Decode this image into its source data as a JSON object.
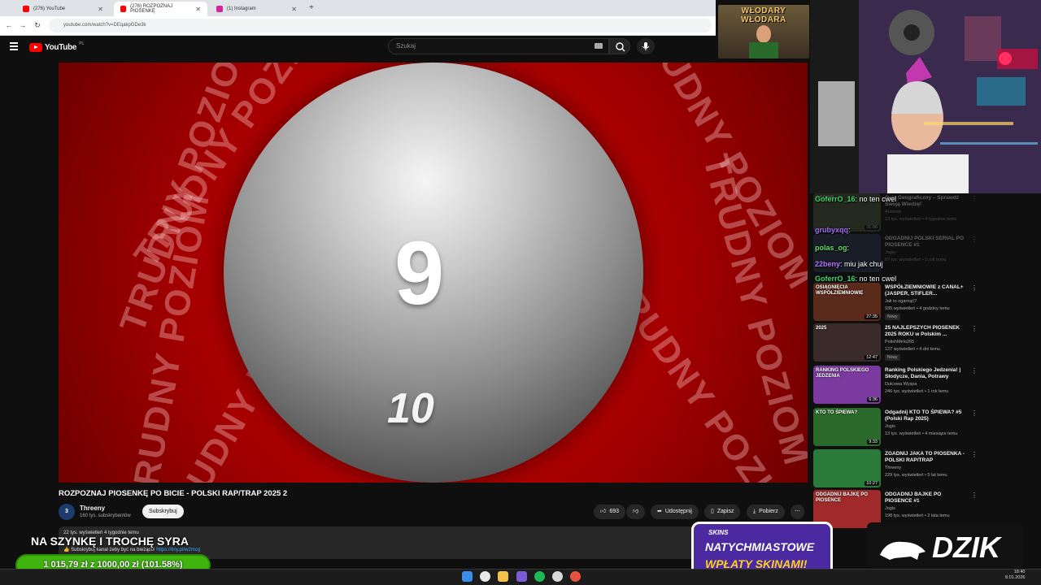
{
  "browser": {
    "tabs": [
      {
        "label": "(276) YouTube"
      },
      {
        "label": "(276) ROZPOZNAJ PIOSENKĘ"
      },
      {
        "label": "(1) Instagram"
      }
    ],
    "url": "youtube.com/watch?v=DEqakpGDe3k"
  },
  "header": {
    "logo": "YouTube",
    "country": "PL",
    "search_placeholder": "Szukaj"
  },
  "video": {
    "ring_text": "TRUDNY POZIOM",
    "big_number": "9",
    "small_number": "10",
    "title": "ROZPOZNAJ PIOSENKĘ PO BICIE - POLSKI RAP/TRAP 2025 2"
  },
  "channel": {
    "avatar_text": "3",
    "name": "Threeny",
    "subs": "160 tys. subskrybentów",
    "subscribe_label": "Subskrybuj"
  },
  "actions": {
    "likes": "693",
    "share": "Udostępnij",
    "save": "Zapisz",
    "download": "Pobierz",
    "more": "⋯"
  },
  "description": {
    "stats": "22 tys. wyświetleń  4 tygodnie temu",
    "line": "👍 Subskrybuj kanał żeby być na bieżąco! ",
    "link": "https://tiny.pl/w2mcg"
  },
  "chat": [
    {
      "user": "GoferrO_16",
      "color": "#3ed96b",
      "text": "no ten cwel"
    },
    {
      "user": "grubyxqq",
      "color": "#a66bff",
      "text": ""
    },
    {
      "user": "polas_og",
      "color": "#5fe05f",
      "text": ""
    },
    {
      "user": "22beny",
      "color": "#b57bff",
      "text": "miu jak chuj"
    },
    {
      "user": "GoferrO_16",
      "color": "#3ed96b",
      "text": "no ten cwel"
    }
  ],
  "sidebar": [
    {
      "thumb_label": "GEOGR",
      "duration": "31:06",
      "title": "Quiz Geograficzny – Sprawdź Swoją Wiedzę!",
      "channel": "Arsenek",
      "meta": "13 tys. wyświetleń • 4 tygodnie temu",
      "badge": "",
      "thumb": "#4a5a3a"
    },
    {
      "thumb_label": "",
      "duration": "",
      "title": "ODGADNIJ POLSKI SERIAL PO PIOSENCE #1",
      "channel": "Jogis",
      "meta": "67 tys. wyświetleń • 1 rok temu",
      "badge": "",
      "thumb": "#2d3a55"
    },
    {
      "thumb_label": "OSIĄGNIĘCIA WSPÓŁZIEMNIOWIE",
      "duration": "27:35",
      "title": "WSPÓŁZIEMNIOWIE z CANAL+ (JASPER, STIFLER...",
      "channel": "Jak to ogarnąć?",
      "meta": "935 wyświetleń • 4 godziny temu",
      "badge": "Nowy",
      "thumb": "#5a2a1a"
    },
    {
      "thumb_label": "2025",
      "duration": "12:47",
      "title": "25 NAJLEPSZYCH PIOSENEK 2025 ROKU w Polskim ...",
      "channel": "PolishMelo265",
      "meta": "127 wyświetleń • 4 dni temu",
      "badge": "Nowy",
      "thumb": "#3a2a2a"
    },
    {
      "thumb_label": "RANKING POLSKIEGO JEDZENIA",
      "duration": "6:36",
      "title": "Ranking Polskiego Jedzenia! | Słodycze, Dania, Potrawy",
      "channel": "Dulcowa Wyspa",
      "meta": "246 tys. wyświetleń • 1 rok temu",
      "badge": "",
      "thumb": "#7a3aa0"
    },
    {
      "thumb_label": "KTO TO ŚPIEWA?",
      "duration": "9:33",
      "title": "Odgadnij KTO TO ŚPIEWA? #5 (Polski Rap 2025)",
      "channel": "Jogis",
      "meta": "13 tys. wyświetleń • 4 miesiące temu",
      "badge": "",
      "thumb": "#2a6a2a"
    },
    {
      "thumb_label": "",
      "duration": "10:27",
      "title": "ZGADNIJ JAKA TO PIOSENKA - POLSKI RAP/TRAP",
      "channel": "Threeny",
      "meta": "229 tys. wyświetleń • 5 lat temu",
      "badge": "",
      "thumb": "#2a7a3a"
    },
    {
      "thumb_label": "ODGADNIJ BAJKĘ PO PIOSENCE",
      "duration": "",
      "title": "ODGADNIJ BAJKE PO PIOSENCE #1",
      "channel": "Jogis",
      "meta": "198 tys. wyświetleń • 2 lata temu",
      "badge": "",
      "thumb": "#a02a2a"
    }
  ],
  "overlays": {
    "badge": "WŁODARY WŁODARA",
    "goal_title": "NA SZYNKĘ I TROCHĘ SYRA",
    "goal_bar": "1 015,79 zł  z  1000,00 zł  (101.58%)",
    "promo_brand": "SKINS",
    "promo_line1": "NATYCHMIASTOWE",
    "promo_line2": "WPŁATY SKINAMI!",
    "dzik": "DZIK"
  },
  "clock": {
    "time": "18:40",
    "date": "8.01.2026"
  }
}
